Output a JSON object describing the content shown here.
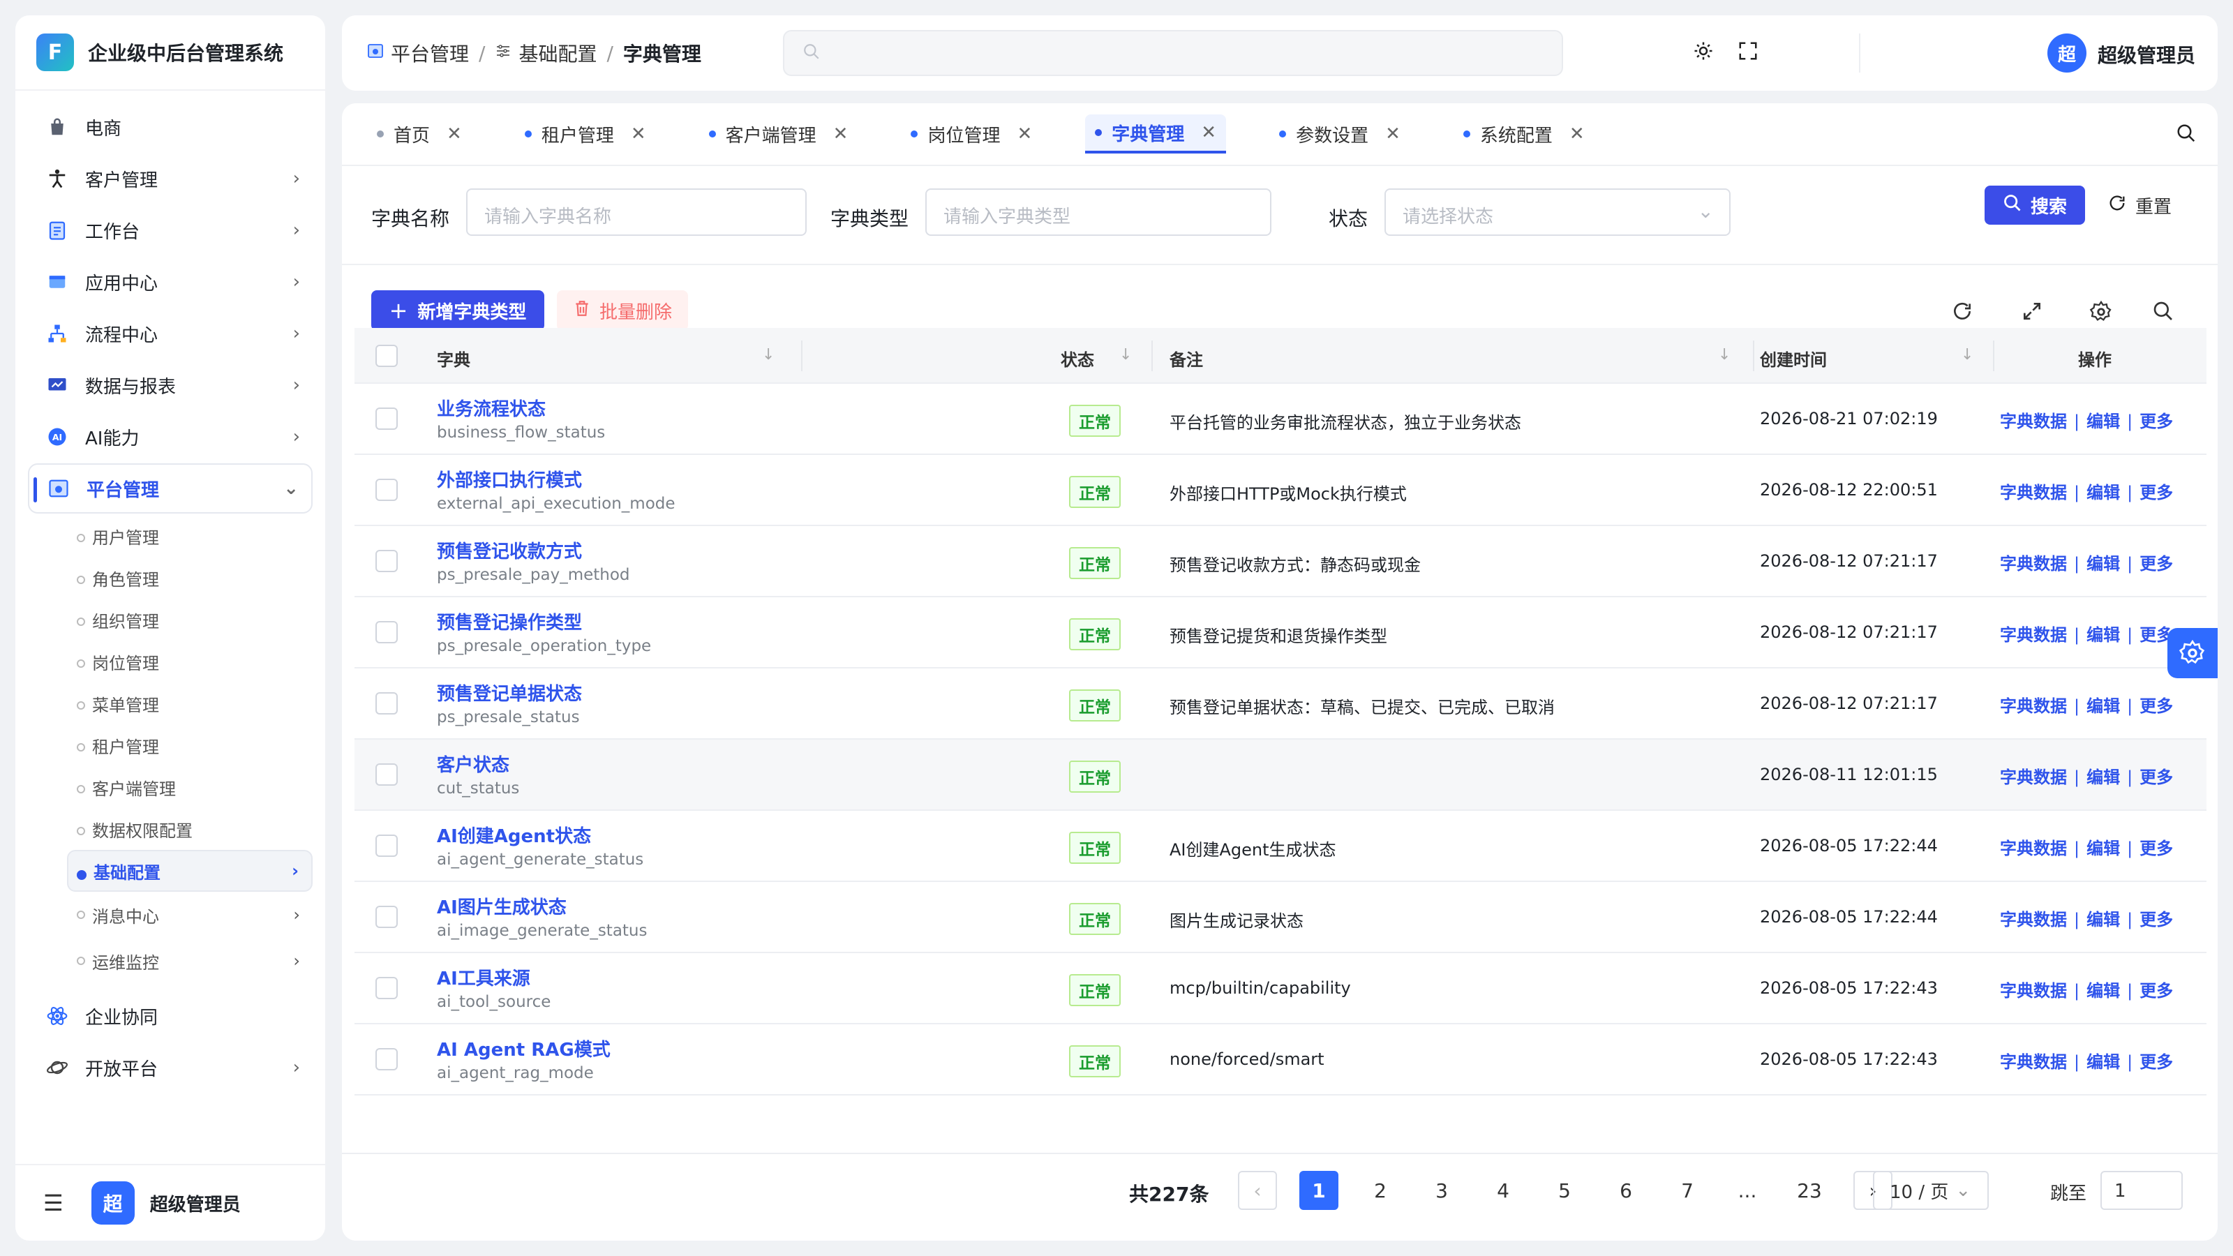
{
  "app": {
    "title": "企业级中后台管理系统",
    "logo_letter": "F",
    "brand_color": "#2f6bff",
    "accent_color": "#3b4de8"
  },
  "sidebar": {
    "items": [
      {
        "label": "电商",
        "icon": "shopping-bag-icon",
        "has_arrow": false
      },
      {
        "label": "客户管理",
        "icon": "person-icon",
        "has_arrow": true
      },
      {
        "label": "工作台",
        "icon": "clipboard-icon",
        "has_arrow": true
      },
      {
        "label": "应用中心",
        "icon": "app-window-icon",
        "has_arrow": true
      },
      {
        "label": "流程中心",
        "icon": "flow-icon",
        "has_arrow": true
      },
      {
        "label": "数据与报表",
        "icon": "report-icon",
        "has_arrow": true
      },
      {
        "label": "AI能力",
        "icon": "ai-icon",
        "has_arrow": true
      },
      {
        "label": "平台管理",
        "icon": "platform-icon",
        "has_arrow": true,
        "expanded": true
      }
    ],
    "sub_items": [
      {
        "label": "用户管理"
      },
      {
        "label": "角色管理"
      },
      {
        "label": "组织管理"
      },
      {
        "label": "岗位管理"
      },
      {
        "label": "菜单管理"
      },
      {
        "label": "租户管理"
      },
      {
        "label": "客户端管理"
      },
      {
        "label": "数据权限配置"
      },
      {
        "label": "基础配置",
        "active": true,
        "has_arrow": true
      },
      {
        "label": "消息中心",
        "has_arrow": true
      },
      {
        "label": "运维监控",
        "has_arrow": true
      }
    ],
    "bottom_items": [
      {
        "label": "企业协同",
        "icon": "atom-icon",
        "has_arrow": false
      },
      {
        "label": "开放平台",
        "icon": "planet-icon",
        "has_arrow": true
      }
    ],
    "footer": {
      "avatar_text": "超",
      "user_name": "超级管理员"
    }
  },
  "header": {
    "breadcrumb": [
      "平台管理",
      "基础配置",
      "字典管理"
    ],
    "search_placeholder": "",
    "avatar_text": "超",
    "user_name": "超级管理员"
  },
  "tabs": [
    {
      "label": "首页",
      "active": false,
      "blue": false
    },
    {
      "label": "租户管理",
      "active": false,
      "blue": true
    },
    {
      "label": "客户端管理",
      "active": false,
      "blue": true
    },
    {
      "label": "岗位管理",
      "active": false,
      "blue": true
    },
    {
      "label": "字典管理",
      "active": true,
      "blue": true
    },
    {
      "label": "参数设置",
      "active": false,
      "blue": true
    },
    {
      "label": "系统配置",
      "active": false,
      "blue": true
    }
  ],
  "filters": {
    "name_label": "字典名称",
    "name_placeholder": "请输入字典名称",
    "type_label": "字典类型",
    "type_placeholder": "请输入字典类型",
    "status_label": "状态",
    "status_placeholder": "请选择状态",
    "search_button": "搜索",
    "reset_button": "重置"
  },
  "toolbar": {
    "add_button": "新增字典类型",
    "batch_delete_button": "批量删除"
  },
  "table": {
    "columns": {
      "dict": "字典",
      "status": "状态",
      "remark": "备注",
      "created": "创建时间",
      "actions": "操作"
    },
    "rows": [
      {
        "name": "业务流程状态",
        "code": "business_flow_status",
        "status": "正常",
        "remark": "平台托管的业务审批流程状态，独立于业务状态",
        "created": "2026-08-21 07:02:19"
      },
      {
        "name": "外部接口执行模式",
        "code": "external_api_execution_mode",
        "status": "正常",
        "remark": "外部接口HTTP或Mock执行模式",
        "created": "2026-08-12 22:00:51"
      },
      {
        "name": "预售登记收款方式",
        "code": "ps_presale_pay_method",
        "status": "正常",
        "remark": "预售登记收款方式：静态码或现金",
        "created": "2026-08-12 07:21:17"
      },
      {
        "name": "预售登记操作类型",
        "code": "ps_presale_operation_type",
        "status": "正常",
        "remark": "预售登记提货和退货操作类型",
        "created": "2026-08-12 07:21:17"
      },
      {
        "name": "预售登记单据状态",
        "code": "ps_presale_status",
        "status": "正常",
        "remark": "预售登记单据状态：草稿、已提交、已完成、已取消",
        "created": "2026-08-12 07:21:17"
      },
      {
        "name": "客户状态",
        "code": "cut_status",
        "status": "正常",
        "remark": "",
        "created": "2026-08-11 12:01:15"
      },
      {
        "name": "AI创建Agent状态",
        "code": "ai_agent_generate_status",
        "status": "正常",
        "remark": "AI创建Agent生成状态",
        "created": "2026-08-05 17:22:44"
      },
      {
        "name": "AI图片生成状态",
        "code": "ai_image_generate_status",
        "status": "正常",
        "remark": "图片生成记录状态",
        "created": "2026-08-05 17:22:44"
      },
      {
        "name": "AI工具来源",
        "code": "ai_tool_source",
        "status": "正常",
        "remark": "mcp/builtin/capability",
        "created": "2026-08-05 17:22:43"
      },
      {
        "name": "AI Agent RAG模式",
        "code": "ai_agent_rag_mode",
        "status": "正常",
        "remark": "none/forced/smart",
        "created": "2026-08-05 17:22:43"
      }
    ],
    "actions": {
      "data": "字典数据",
      "edit": "编辑",
      "more": "更多"
    }
  },
  "pagination": {
    "total": "共227条",
    "pages": [
      "1",
      "2",
      "3",
      "4",
      "5",
      "6",
      "7",
      "...",
      "23"
    ],
    "current": "1",
    "page_size": "10 / 页",
    "jump_label": "跳至",
    "jump_value": "1"
  }
}
